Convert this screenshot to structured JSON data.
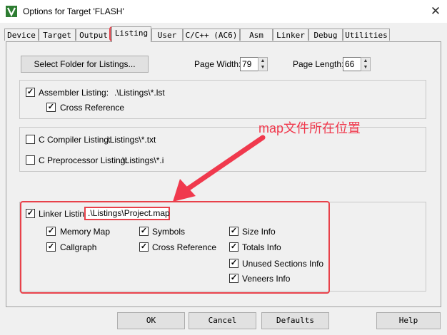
{
  "window": {
    "title": "Options for Target 'FLASH'",
    "icon": "keil-uvision-icon"
  },
  "tabs": [
    {
      "label": "Device",
      "active": false
    },
    {
      "label": "Target",
      "active": false
    },
    {
      "label": "Output",
      "active": false
    },
    {
      "label": "Listing",
      "active": true
    },
    {
      "label": "User",
      "active": false
    },
    {
      "label": "C/C++ (AC6)",
      "active": false
    },
    {
      "label": "Asm",
      "active": false
    },
    {
      "label": "Linker",
      "active": false
    },
    {
      "label": "Debug",
      "active": false
    },
    {
      "label": "Utilities",
      "active": false
    }
  ],
  "toolbar": {
    "select_folder_label": "Select Folder for Listings...",
    "page_width_label": "Page Width:",
    "page_width_value": "79",
    "page_length_label": "Page Length:",
    "page_length_value": "66"
  },
  "assembler": {
    "listing_label": "Assembler Listing:",
    "listing_path": ".\\Listings\\*.lst",
    "listing_checked": true,
    "cross_ref_label": "Cross Reference",
    "cross_ref_checked": true
  },
  "compiler": {
    "c_compiler_label": "C Compiler Listing:",
    "c_compiler_path": ".\\Listings\\*.txt",
    "c_compiler_checked": false,
    "c_preprocessor_label": "C Preprocessor Listing:",
    "c_preprocessor_path": ".\\Listings\\*.i",
    "c_preprocessor_checked": false
  },
  "linker": {
    "listing_label": "Linker Listing:",
    "listing_path": ".\\Listings\\Project.map",
    "listing_checked": true,
    "options": [
      {
        "label": "Memory Map",
        "checked": true
      },
      {
        "label": "Symbols",
        "checked": true
      },
      {
        "label": "Size Info",
        "checked": true
      },
      {
        "label": "Callgraph",
        "checked": true
      },
      {
        "label": "Cross Reference",
        "checked": true
      },
      {
        "label": "Totals Info",
        "checked": true
      },
      {
        "label": "Unused Sections Info",
        "checked": true
      },
      {
        "label": "Veneers Info",
        "checked": true
      }
    ]
  },
  "annotation": {
    "text": "map文件所在位置",
    "color": "#f0394d"
  },
  "footer": {
    "ok_label": "OK",
    "cancel_label": "Cancel",
    "defaults_label": "Defaults",
    "help_label": "Help"
  }
}
